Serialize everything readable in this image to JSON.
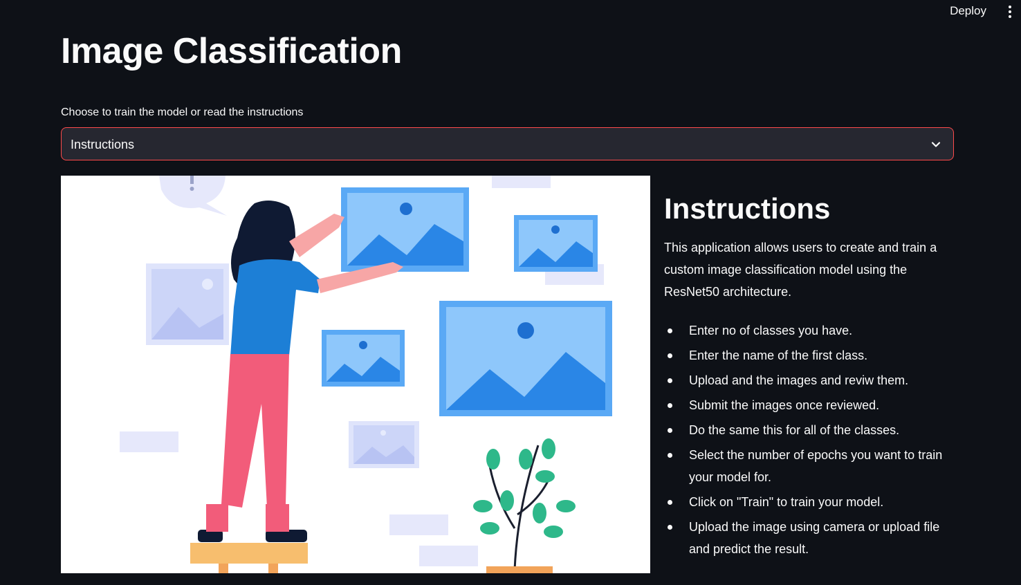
{
  "header": {
    "deploy_label": "Deploy"
  },
  "page": {
    "title": "Image Classification"
  },
  "mode_select": {
    "label": "Choose to train the model or read the instructions",
    "selected": "Instructions"
  },
  "instructions": {
    "heading": "Instructions",
    "intro": "This application allows users to create and train a custom image classification model using the ResNet50 architecture.",
    "steps": [
      "Enter no of classes you have.",
      "Enter the name of the first class.",
      "Upload and the images and reviw them.",
      "Submit the images once reviewed.",
      "Do the same this for all of the classes.",
      "Select the number of epochs you want to train your model for.",
      "Click on \"Train\" to train your model.",
      "Upload the image using camera or upload file and predict the result."
    ]
  },
  "colors": {
    "background": "#0e1117",
    "select_bg": "#262730",
    "accent_border": "#ff4b4b",
    "text": "#fafafa"
  },
  "icons": {
    "menu": "kebab-menu-icon",
    "dropdown": "chevron-down-icon"
  }
}
